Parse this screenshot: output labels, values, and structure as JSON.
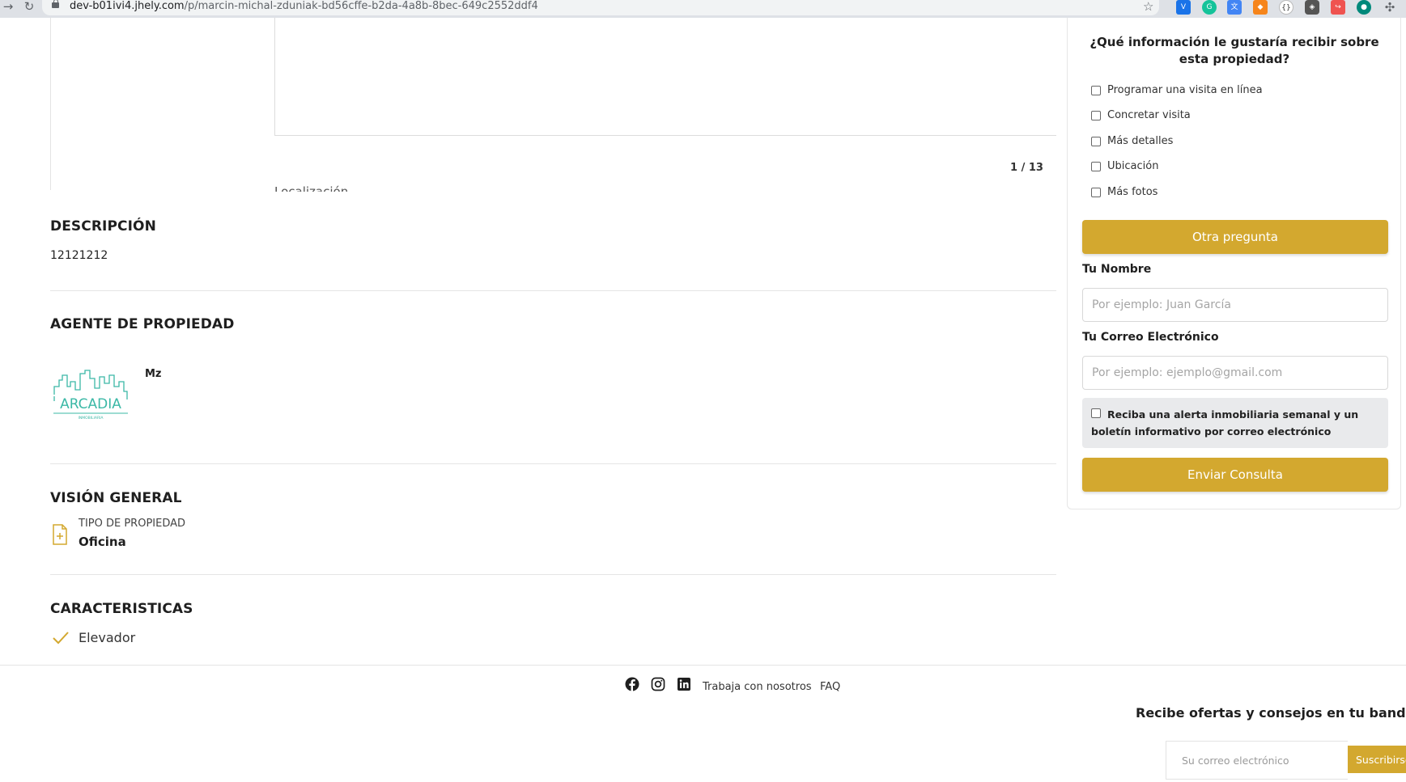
{
  "browser": {
    "url_host": "dev-b01ivi4.jhely.com",
    "url_path": "/p/marcin-michal-zduniak-bd56cffe-b2da-4a8b-8bec-649c2552ddf4"
  },
  "gallery": {
    "counter": "1 / 13",
    "cut_label": "Localización"
  },
  "description": {
    "title": "DESCRIPCIÓN",
    "text": "12121212"
  },
  "agent": {
    "title": "AGENTE DE PROPIEDAD",
    "logo_text": "ARCADIA",
    "logo_subtext": "INMOBILIARIA",
    "name": "Mz"
  },
  "overview": {
    "title": "VISIÓN GENERAL",
    "property_type_label": "TIPO DE PROPIEDAD",
    "property_type_value": "Oficina"
  },
  "features": {
    "title": "CARACTERISTICAS",
    "items": [
      "Elevador"
    ]
  },
  "form": {
    "question": "¿Qué información le gustaría recibir sobre esta propiedad?",
    "options": [
      "Programar una visita en línea",
      "Concretar visita",
      "Más detalles",
      "Ubicación",
      "Más fotos"
    ],
    "other_question_label": "Otra pregunta",
    "name_label": "Tu Nombre",
    "name_placeholder": "Por ejemplo: Juan García",
    "email_label": "Tu Correo Electrónico",
    "email_placeholder": "Por ejemplo: ejemplo@gmail.com",
    "newsletter_text": "Reciba una alerta inmobiliaria semanal y un boletín informativo por correo electrónico",
    "submit_label": "Enviar Consulta"
  },
  "footer": {
    "links": [
      "Trabaja con nosotros",
      "FAQ"
    ],
    "social_icons": [
      "facebook-icon",
      "instagram-icon",
      "linkedin-icon"
    ],
    "subscribe_title": "Recibe ofertas y consejos en tu bandeja de entrada",
    "subscribe_placeholder": "Su correo electrónico",
    "subscribe_button": "Suscribirse"
  },
  "colors": {
    "accent": "#d3a82f",
    "logo": "#3bb8a6"
  }
}
